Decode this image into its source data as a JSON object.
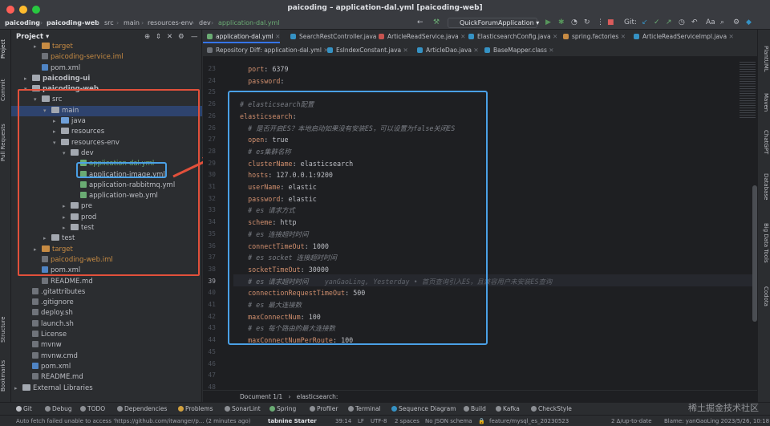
{
  "window": {
    "title": "paicoding – application-dal.yml [paicoding-web]"
  },
  "toolbar": {
    "breadcrumb": [
      "paicoding",
      "paicoding-web",
      "src",
      "main",
      "resources-env",
      "dev",
      "application-dal.yml"
    ],
    "run_config": "QuickForumApplication",
    "git_label": "Git:"
  },
  "left_strip": {
    "items": [
      "Project",
      "Commit",
      "Pull Requests",
      "Structure",
      "Bookmarks"
    ]
  },
  "right_strip": {
    "items": [
      "PlantUML",
      "Maven",
      "ChatGPT",
      "Database",
      "Big Data Tools",
      "Codota"
    ]
  },
  "project": {
    "title": "Project",
    "tree": [
      {
        "label": "target",
        "indent": 2,
        "type": "folder-ex",
        "arrow": ">",
        "cls": "orange"
      },
      {
        "label": "paicoding-service.iml",
        "indent": 2,
        "type": "file",
        "arrow": "",
        "cls": "orange"
      },
      {
        "label": "pom.xml",
        "indent": 2,
        "type": "file-xml",
        "arrow": "",
        "cls": ""
      },
      {
        "label": "paicoding-ui",
        "indent": 1,
        "type": "folder",
        "arrow": ">",
        "cls": "bold"
      },
      {
        "label": "paicoding-web",
        "indent": 1,
        "type": "folder",
        "arrow": "v",
        "cls": "bold"
      },
      {
        "label": "src",
        "indent": 2,
        "type": "folder",
        "arrow": "v",
        "cls": ""
      },
      {
        "label": "main",
        "indent": 3,
        "type": "folder",
        "arrow": "v",
        "cls": "sel"
      },
      {
        "label": "java",
        "indent": 4,
        "type": "folder-src",
        "arrow": ">",
        "cls": ""
      },
      {
        "label": "resources",
        "indent": 4,
        "type": "folder",
        "arrow": ">",
        "cls": ""
      },
      {
        "label": "resources-env",
        "indent": 4,
        "type": "folder",
        "arrow": "v",
        "cls": ""
      },
      {
        "label": "dev",
        "indent": 5,
        "type": "folder",
        "arrow": "v",
        "cls": ""
      },
      {
        "label": "application-dal.yml",
        "indent": 6,
        "type": "file-yml",
        "arrow": "",
        "cls": "pick"
      },
      {
        "label": "application-image.yml",
        "indent": 6,
        "type": "file-yml",
        "arrow": "",
        "cls": ""
      },
      {
        "label": "application-rabbitmq.yml",
        "indent": 6,
        "type": "file-yml",
        "arrow": "",
        "cls": ""
      },
      {
        "label": "application-web.yml",
        "indent": 6,
        "type": "file-yml",
        "arrow": "",
        "cls": ""
      },
      {
        "label": "pre",
        "indent": 5,
        "type": "folder",
        "arrow": ">",
        "cls": ""
      },
      {
        "label": "prod",
        "indent": 5,
        "type": "folder",
        "arrow": ">",
        "cls": ""
      },
      {
        "label": "test",
        "indent": 5,
        "type": "folder",
        "arrow": ">",
        "cls": ""
      },
      {
        "label": "test",
        "indent": 3,
        "type": "folder",
        "arrow": ">",
        "cls": ""
      },
      {
        "label": "target",
        "indent": 2,
        "type": "folder-ex",
        "arrow": ">",
        "cls": "orange"
      },
      {
        "label": "paicoding-web.iml",
        "indent": 2,
        "type": "file",
        "arrow": "",
        "cls": "orange"
      },
      {
        "label": "pom.xml",
        "indent": 2,
        "type": "file-xml",
        "arrow": "",
        "cls": ""
      },
      {
        "label": "README.md",
        "indent": 2,
        "type": "file",
        "arrow": "",
        "cls": ""
      },
      {
        "label": ".gitattributes",
        "indent": 1,
        "type": "file",
        "arrow": "",
        "cls": ""
      },
      {
        "label": ".gitignore",
        "indent": 1,
        "type": "file",
        "arrow": "",
        "cls": ""
      },
      {
        "label": "deploy.sh",
        "indent": 1,
        "type": "file",
        "arrow": "",
        "cls": ""
      },
      {
        "label": "launch.sh",
        "indent": 1,
        "type": "file",
        "arrow": "",
        "cls": ""
      },
      {
        "label": "License",
        "indent": 1,
        "type": "file",
        "arrow": "",
        "cls": ""
      },
      {
        "label": "mvnw",
        "indent": 1,
        "type": "file",
        "arrow": "",
        "cls": ""
      },
      {
        "label": "mvnw.cmd",
        "indent": 1,
        "type": "file",
        "arrow": "",
        "cls": ""
      },
      {
        "label": "pom.xml",
        "indent": 1,
        "type": "file-xml",
        "arrow": "",
        "cls": ""
      },
      {
        "label": "README.md",
        "indent": 1,
        "type": "file",
        "arrow": "",
        "cls": ""
      },
      {
        "label": "External Libraries",
        "indent": 0,
        "type": "folder",
        "arrow": ">",
        "cls": ""
      }
    ]
  },
  "tabs": {
    "row1": [
      {
        "label": "application-dal.yml",
        "color": "#6aab73",
        "active": true
      },
      {
        "label": "SearchRestController.java",
        "color": "#3592c4"
      },
      {
        "label": "ArticleReadService.java",
        "color": "#c75450"
      },
      {
        "label": "ElasticsearchConfig.java",
        "color": "#3592c4"
      },
      {
        "label": "spring.factories",
        "color": "#c78b43"
      },
      {
        "label": "ArticleReadServiceImpl.java",
        "color": "#3592c4"
      }
    ],
    "row2": [
      {
        "label": "Repository Diff: application-dal.yml",
        "color": "#6f737a"
      },
      {
        "label": "EsIndexConstant.java",
        "color": "#3592c4"
      },
      {
        "label": "ArticleDao.java",
        "color": "#3592c4"
      },
      {
        "label": "BaseMapper.class",
        "color": "#3592c4"
      }
    ]
  },
  "editor": {
    "lines": [
      {
        "n": "23",
        "parts": [
          [
            "k",
            "  port"
          ],
          [
            "v",
            ": 6379"
          ]
        ]
      },
      {
        "n": "24",
        "parts": [
          [
            "k",
            "  password"
          ],
          [
            "v",
            ":"
          ]
        ]
      },
      {
        "n": "25",
        "parts": []
      },
      {
        "n": "26",
        "parts": [
          [
            "c",
            "# elasticsearch配置"
          ]
        ]
      },
      {
        "n": "26",
        "parts": [
          [
            "k",
            "elasticsearch"
          ],
          [
            "v",
            ":"
          ]
        ]
      },
      {
        "n": "26",
        "parts": [
          [
            "c",
            "  # 是否开启ES？本地启动如果没有安装ES，可以设置为false关闭ES"
          ]
        ]
      },
      {
        "n": "27",
        "parts": [
          [
            "k",
            "  open"
          ],
          [
            "v",
            ": true"
          ]
        ]
      },
      {
        "n": "28",
        "parts": [
          [
            "c",
            "  # es集群名称"
          ]
        ]
      },
      {
        "n": "29",
        "parts": [
          [
            "k",
            "  clusterName"
          ],
          [
            "v",
            ": elasticsearch"
          ]
        ]
      },
      {
        "n": "30",
        "parts": [
          [
            "k",
            "  hosts"
          ],
          [
            "v",
            ": 127.0.0.1:9200"
          ]
        ]
      },
      {
        "n": "31",
        "parts": [
          [
            "k",
            "  userName"
          ],
          [
            "v",
            ": elastic"
          ]
        ]
      },
      {
        "n": "32",
        "parts": [
          [
            "k",
            "  password"
          ],
          [
            "v",
            ": elastic"
          ]
        ]
      },
      {
        "n": "33",
        "parts": [
          [
            "c",
            "  # es 请求方式"
          ]
        ]
      },
      {
        "n": "34",
        "parts": [
          [
            "k",
            "  scheme"
          ],
          [
            "v",
            ": http"
          ]
        ]
      },
      {
        "n": "35",
        "parts": [
          [
            "c",
            "  # es 连接超时时间"
          ]
        ]
      },
      {
        "n": "36",
        "parts": [
          [
            "k",
            "  connectTimeOut"
          ],
          [
            "v",
            ": 1000"
          ]
        ]
      },
      {
        "n": "37",
        "parts": [
          [
            "c",
            "  # es socket 连接超时时间"
          ]
        ]
      },
      {
        "n": "38",
        "parts": [
          [
            "k",
            "  socketTimeOut"
          ],
          [
            "v",
            ": 30000"
          ]
        ]
      },
      {
        "n": "39",
        "parts": [
          [
            "c",
            "  # es 请求超时时间"
          ],
          [
            "blame",
            "    yanGaoLing, Yesterday • 首页查询引入ES，且兼容用户未安装ES查询"
          ]
        ],
        "current": true
      },
      {
        "n": "40",
        "parts": [
          [
            "k",
            "  connectionRequestTimeOut"
          ],
          [
            "v",
            ": 500"
          ]
        ]
      },
      {
        "n": "41",
        "parts": [
          [
            "c",
            "  # es 最大连接数"
          ]
        ]
      },
      {
        "n": "42",
        "parts": [
          [
            "k",
            "  maxConnectNum"
          ],
          [
            "v",
            ": 100"
          ]
        ]
      },
      {
        "n": "43",
        "parts": [
          [
            "c",
            "  # es 每个路由的最大连接数"
          ]
        ]
      },
      {
        "n": "44",
        "parts": [
          [
            "k",
            "  maxConnectNumPerRoute"
          ],
          [
            "v",
            ": 100"
          ]
        ]
      },
      {
        "n": "45",
        "parts": []
      },
      {
        "n": "46",
        "parts": []
      },
      {
        "n": "47",
        "parts": []
      },
      {
        "n": "48",
        "parts": []
      }
    ]
  },
  "editor_crumbs": {
    "doc": "Document 1/1",
    "path": "elasticsearch:"
  },
  "bottom_tools": [
    {
      "label": "Git",
      "color": "#bcbec4"
    },
    {
      "label": "Debug",
      "color": "#8c8f94"
    },
    {
      "label": "TODO",
      "color": "#8c8f94"
    },
    {
      "label": "Dependencies",
      "color": "#8c8f94"
    },
    {
      "label": "Problems",
      "color": "#d2a13e"
    },
    {
      "label": "SonarLint",
      "color": "#8c8f94"
    },
    {
      "label": "Spring",
      "color": "#6aab73"
    },
    {
      "label": "Profiler",
      "color": "#8c8f94"
    },
    {
      "label": "Terminal",
      "color": "#8c8f94"
    },
    {
      "label": "Sequence Diagram",
      "color": "#3592c4"
    },
    {
      "label": "Build",
      "color": "#8c8f94"
    },
    {
      "label": "Kafka",
      "color": "#8c8f94"
    },
    {
      "label": "CheckStyle",
      "color": "#8c8f94"
    }
  ],
  "watermark": "稀土掘金技术社区",
  "status": {
    "message": "Auto fetch failed unable to access 'https://github.com/itwanger/p... (2 minutes ago)",
    "tabnine": "tabnine Starter",
    "position": "39:14",
    "line_sep": "LF",
    "encoding": "UTF-8",
    "indent": "2 spaces",
    "schema": "No JSON schema",
    "branch": "feature/mysql_es_20230523",
    "sync": "2 ∆/up-to-date",
    "blame": "Blame: yanGaoLing 2023/5/26, 10:18"
  }
}
